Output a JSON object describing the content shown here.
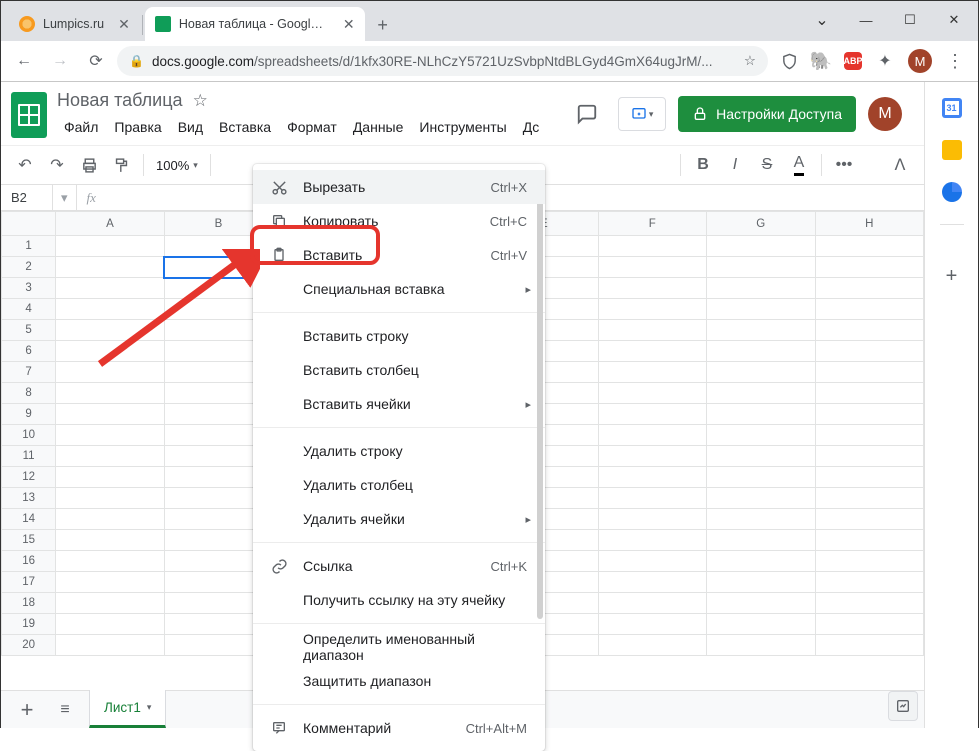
{
  "browser": {
    "tabs": [
      {
        "title": "Lumpics.ru",
        "favicon_color": "#f79a1f"
      },
      {
        "title": "Новая таблица - Google Таблиц",
        "favicon_color": "#0f9d58"
      }
    ],
    "url_host": "docs.google.com",
    "url_path": "/spreadsheets/d/1kfx30RE-NLhCzY5721UzSvbpNtdBLGyd4GmX64ugJrM/...",
    "avatar_letter": "М"
  },
  "doc": {
    "title": "Новая таблица",
    "menus": [
      "Файл",
      "Правка",
      "Вид",
      "Вставка",
      "Формат",
      "Данные",
      "Инструменты",
      "Дс"
    ],
    "share_label": "Настройки Доступа",
    "zoom": "100%",
    "cell_ref": "B2",
    "columns": [
      "A",
      "B",
      "C",
      "D",
      "E",
      "F",
      "G",
      "H"
    ],
    "rows": [
      "1",
      "2",
      "3",
      "4",
      "5",
      "6",
      "7",
      "8",
      "9",
      "10",
      "11",
      "12",
      "13",
      "14",
      "15",
      "16",
      "17",
      "18",
      "19",
      "20"
    ],
    "selected": {
      "row": 2,
      "col": 2
    },
    "sheet_name": "Лист1"
  },
  "ctx": {
    "items": [
      {
        "icon": "cut",
        "label": "Вырезать",
        "shortcut": "Ctrl+X",
        "hover": true
      },
      {
        "icon": "copy",
        "label": "Копировать",
        "shortcut": "Ctrl+C"
      },
      {
        "icon": "paste",
        "label": "Вставить",
        "shortcut": "Ctrl+V",
        "highlight": true
      },
      {
        "label": "Специальная вставка",
        "sub": true
      },
      {
        "sep": true
      },
      {
        "label": "Вставить строку"
      },
      {
        "label": "Вставить столбец"
      },
      {
        "label": "Вставить ячейки",
        "sub": true
      },
      {
        "sep": true
      },
      {
        "label": "Удалить строку"
      },
      {
        "label": "Удалить столбец"
      },
      {
        "label": "Удалить ячейки",
        "sub": true
      },
      {
        "sep": true
      },
      {
        "icon": "link",
        "label": "Ссылка",
        "shortcut": "Ctrl+K"
      },
      {
        "label": "Получить ссылку на эту ячейку"
      },
      {
        "sep": true
      },
      {
        "label": "Определить именованный диапазон"
      },
      {
        "label": "Защитить диапазон"
      },
      {
        "sep": true
      },
      {
        "icon": "comment",
        "label": "Комментарий",
        "shortcut": "Ctrl+Alt+M"
      }
    ]
  }
}
